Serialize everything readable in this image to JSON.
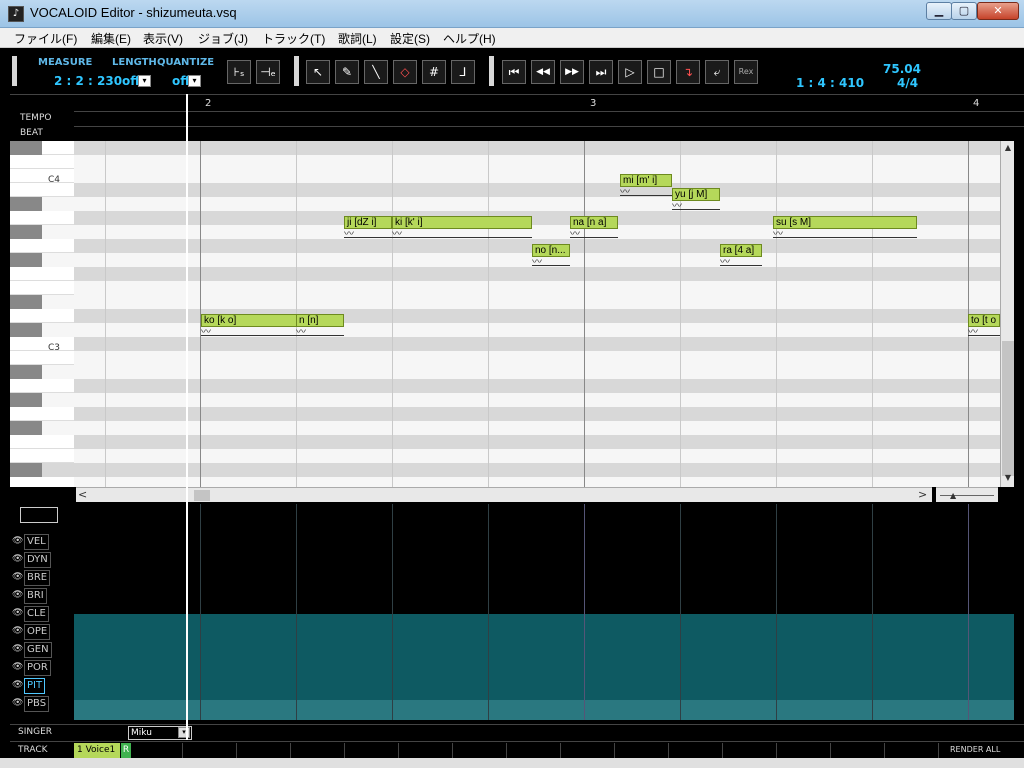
{
  "window": {
    "title": "VOCALOID Editor - shizumeuta.vsq",
    "icon": "vocaloid-app-icon",
    "min_label": "▁",
    "max_label": "▢",
    "close_label": "✕"
  },
  "menu": {
    "items": [
      "ファイル(F)",
      "編集(E)",
      "表示(V)",
      "ジョブ(J)",
      "トラック(T)",
      "歌詞(L)",
      "設定(S)",
      "ヘルプ(H)"
    ]
  },
  "toolbar": {
    "measure_label": "MEASURE",
    "measure_value": "2 : 2 : 230",
    "length_label": "LENGTH",
    "length_value": "off",
    "quantize_label": "QUANTIZE",
    "quantize_value": "off",
    "drop_glyph": "▾",
    "position_value": "1 : 4 : 410",
    "tempo_value": "75.04",
    "beat_value": "4/4",
    "buttons": {
      "start_marker": "⊦ₛ",
      "end_marker": "⊣ₑ",
      "pointer": "↖",
      "pencil": "✎",
      "line": "╲",
      "eraser": "◇",
      "grid": "#",
      "curve": "⅃",
      "go_start": "⏮",
      "rewind": "◀◀",
      "forward": "▶▶",
      "go_end": "⏭",
      "play": "▷",
      "stop": "□",
      "follow": "↴",
      "loop": "⤶",
      "rex": "Rex"
    }
  },
  "ruler": {
    "tempo_label": "TEMPO",
    "beat_label": "BEAT",
    "measures": [
      "2",
      "3",
      "4"
    ]
  },
  "piano_roll": {
    "octave_labels": [
      "C4",
      "C3"
    ],
    "notes": [
      {
        "lyric": "ko [k o]"
      },
      {
        "lyric": "n [n]"
      },
      {
        "lyric": "ji [dZ i]"
      },
      {
        "lyric": "ki [k' i]"
      },
      {
        "lyric": "no [n..."
      },
      {
        "lyric": "na [n a]"
      },
      {
        "lyric": "mi [m' i]"
      },
      {
        "lyric": "yu [j M]"
      },
      {
        "lyric": "ra [4 a]"
      },
      {
        "lyric": "su [s M]"
      },
      {
        "lyric": "to [t o"
      }
    ],
    "vibrato_glyph": "〰"
  },
  "scroll": {
    "left_arrow": "<",
    "right_arrow": ">",
    "up_arrow": "▲",
    "down_arrow": "▼",
    "zoom_thumb": "▲"
  },
  "controls": {
    "eye_glyph": "👁",
    "items": [
      "VEL",
      "DYN",
      "BRE",
      "BRI",
      "CLE",
      "OPE",
      "GEN",
      "POR",
      "PIT",
      "PBS"
    ],
    "active": "PIT"
  },
  "singer": {
    "label": "SINGER",
    "name": "Miku",
    "drop_glyph": "▾"
  },
  "track": {
    "label": "TRACK",
    "tab_name": "1 Voice1",
    "render_flag": "R",
    "render_all": "RENDER ALL"
  },
  "colors": {
    "note_fill": "#b5d85a",
    "accent_text": "#2fc6ff",
    "curve_fill": "#0e5a62"
  }
}
